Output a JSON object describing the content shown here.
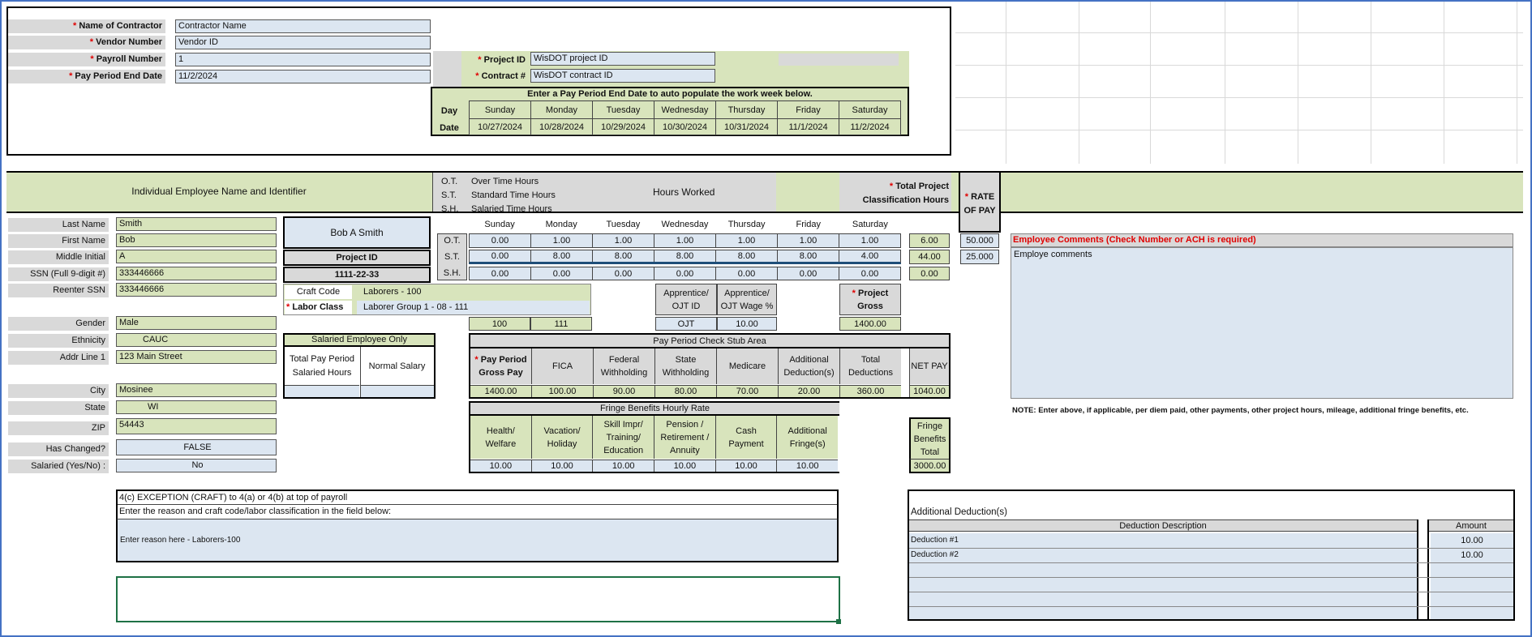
{
  "header": {
    "contractor_label": "Name of Contractor",
    "contractor_value": "Contractor Name",
    "vendor_label": "Vendor Number",
    "vendor_value": "Vendor ID",
    "payroll_label": "Payroll Number",
    "payroll_value": "1",
    "period_label": "Pay Period End Date",
    "period_value": "11/2/2024",
    "project_label": "Project ID",
    "project_value": "WisDOT project ID",
    "contract_label": "Contract #",
    "contract_value": "WisDOT contract ID",
    "star": "*",
    "week_note": "Enter a Pay Period End Date to auto populate the work week below.",
    "day_label": "Day",
    "date_label": "Date",
    "days": [
      "Sunday",
      "Monday",
      "Tuesday",
      "Wednesday",
      "Thursday",
      "Friday",
      "Saturday"
    ],
    "dates": [
      "10/27/2024",
      "10/28/2024",
      "10/29/2024",
      "10/30/2024",
      "10/31/2024",
      "11/1/2024",
      "11/2/2024"
    ]
  },
  "band": {
    "employee_title": "Individual Employee Name and Identifier",
    "ot_code": "O.T.",
    "ot_text": "Over Time Hours",
    "st_code": "S.T.",
    "st_text": "Standard Time Hours",
    "sh_code": "S.H.",
    "sh_text": "Salaried Time Hours",
    "hours_worked": "Hours Worked",
    "total_hours_1": "Total Project",
    "total_hours_2": "Classification Hours",
    "rate_1": "RATE",
    "rate_2": "OF PAY"
  },
  "employee": {
    "fields": [
      {
        "label": "Last Name",
        "value": "Smith"
      },
      {
        "label": "First Name",
        "value": "Bob"
      },
      {
        "label": "Middle Initial",
        "value": "A"
      },
      {
        "label": "SSN (Full 9-digit #)",
        "value": "333446666"
      },
      {
        "label": "Reenter SSN",
        "value": "333446666"
      },
      {
        "label": "Gender",
        "value": "Male"
      },
      {
        "label": "Ethnicity",
        "value": "CAUC"
      },
      {
        "label": "Addr Line 1",
        "value": "123 Main Street"
      },
      {
        "label": "City",
        "value": "Mosinee"
      },
      {
        "label": "State",
        "value": "WI"
      },
      {
        "label": "ZIP",
        "value": "54443"
      },
      {
        "label": "Has Changed?",
        "value": "FALSE"
      },
      {
        "label": "Salaried (Yes/No) :",
        "value": "No"
      }
    ],
    "full_name": "Bob A Smith",
    "project_id_label": "Project ID",
    "project_id_value": "1111-22-33"
  },
  "hours": {
    "days": [
      "Sunday",
      "Monday",
      "Tuesday",
      "Wednesday",
      "Thursday",
      "Friday",
      "Saturday"
    ],
    "ot": [
      "0.00",
      "1.00",
      "1.00",
      "1.00",
      "1.00",
      "1.00",
      "1.00"
    ],
    "st": [
      "0.00",
      "8.00",
      "8.00",
      "8.00",
      "8.00",
      "8.00",
      "4.00"
    ],
    "sh": [
      "0.00",
      "0.00",
      "0.00",
      "0.00",
      "0.00",
      "0.00",
      "0.00"
    ],
    "ot_total": "6.00",
    "st_total": "44.00",
    "sh_total": "0.00",
    "ot_rate": "50.000",
    "st_rate": "25.000"
  },
  "craft": {
    "craft_label": "Craft Code",
    "craft_value": "Laborers - 100",
    "class_label": "Labor Class",
    "class_value": "Laborer Group 1 - 08 - 111",
    "code1": "100",
    "code2": "111",
    "app_id_label_1": "Apprentice/",
    "app_id_label_2": "OJT  ID",
    "app_pct_label_1": "Apprentice/",
    "app_pct_label_2": "OJT Wage %",
    "app_id_value": "OJT",
    "app_pct_value": "10.00",
    "gross_label_1": "Project",
    "gross_label_2": "Gross",
    "gross_value": "1400.00"
  },
  "salaried": {
    "title": "Salaried Employee Only",
    "total_label_1": "Total Pay Period",
    "total_label_2": "Salaried Hours",
    "normal_label": "Normal Salary"
  },
  "stub": {
    "title": "Pay Period Check Stub Area",
    "headers": [
      [
        "Pay Period",
        "Gross Pay"
      ],
      [
        "FICA",
        ""
      ],
      [
        "Federal",
        "Withholding"
      ],
      [
        "State",
        "Withholding"
      ],
      [
        "Medicare",
        ""
      ],
      [
        "Additional",
        "Deduction(s)"
      ],
      [
        "Total",
        "Deductions"
      ]
    ],
    "values": [
      "1400.00",
      "100.00",
      "90.00",
      "80.00",
      "70.00",
      "20.00",
      "360.00"
    ],
    "net_label": "NET PAY",
    "net_value": "1040.00"
  },
  "fringe": {
    "title": "Fringe Benefits Hourly Rate",
    "headers": [
      [
        "Health/",
        "Welfare",
        ""
      ],
      [
        "Vacation/",
        "Holiday",
        ""
      ],
      [
        "Skill Impr/",
        "Training/",
        "Education"
      ],
      [
        "Pension /",
        "Retirement /",
        "Annuity"
      ],
      [
        "Cash",
        "Payment",
        ""
      ],
      [
        "Additional",
        "Fringe(s)",
        ""
      ]
    ],
    "values": [
      "10.00",
      "10.00",
      "10.00",
      "10.00",
      "10.00",
      "10.00"
    ],
    "total_label": [
      "Fringe",
      "Benefits",
      "Total"
    ],
    "total_value": "3000.00"
  },
  "comments": {
    "title": "Employee Comments (Check Number or ACH is required)",
    "text": "Employe comments",
    "note": "NOTE: Enter above, if applicable, per diem paid, other payments, other project hours, mileage, additional fringe benefits, etc."
  },
  "exception": {
    "line1": "4(c) EXCEPTION (CRAFT) to 4(a) or 4(b) at top of payroll",
    "line2": "Enter the reason and craft code/labor classification in the field below:",
    "reason": "Enter reason here - Laborers-100"
  },
  "deductions": {
    "title": "Additional Deduction(s)",
    "desc_header": "Deduction Description",
    "amount_header": "Amount",
    "rows": [
      {
        "desc": "Deduction #1",
        "amount": "10.00"
      },
      {
        "desc": "Deduction #2",
        "amount": "10.00"
      }
    ]
  }
}
